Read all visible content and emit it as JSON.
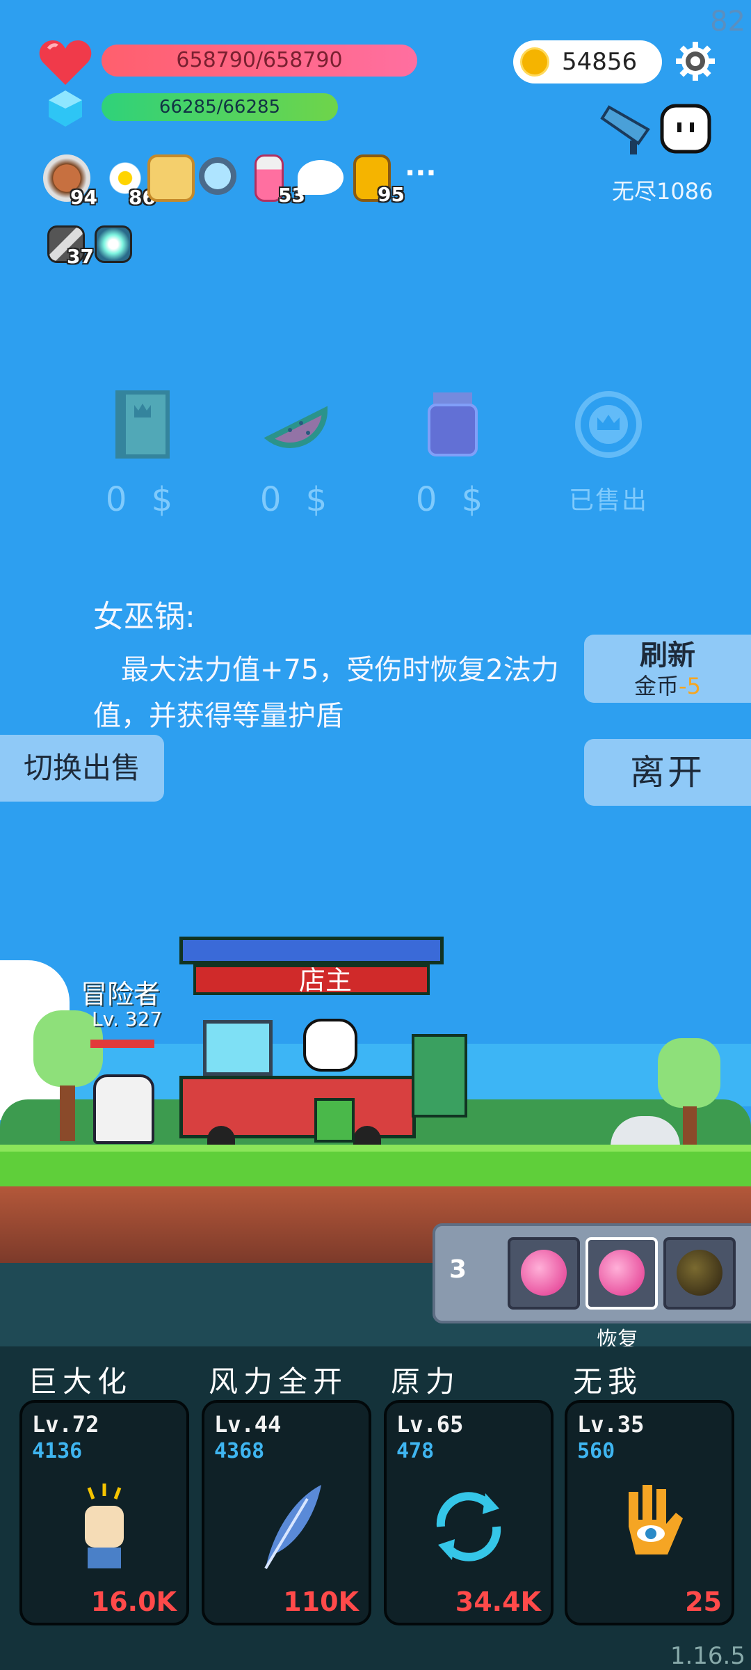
{
  "fps": "82",
  "version": "1.16.5",
  "status": {
    "hp": "658790/658790",
    "mp": "66285/66285",
    "gold": "54856",
    "endless": "无尽1086"
  },
  "buffs": [
    {
      "name": "shield-buff-icon",
      "count": "94"
    },
    {
      "name": "flower-buff-icon",
      "count": "86"
    },
    {
      "name": "scroll-buff-icon",
      "count": ""
    },
    {
      "name": "magnifier-buff-icon",
      "count": ""
    },
    {
      "name": "potion-buff-icon",
      "count": "53"
    },
    {
      "name": "wing-buff-icon",
      "count": ""
    },
    {
      "name": "book-buff-icon",
      "count": "95"
    },
    {
      "name": "sword-buff-icon",
      "count": "37"
    },
    {
      "name": "lightbulb-buff-icon",
      "count": ""
    }
  ],
  "more": "···",
  "shop": {
    "items": [
      {
        "name": "book",
        "price": "0 $"
      },
      {
        "name": "watermelon",
        "price": "0 $"
      },
      {
        "name": "jam-jar",
        "price": "0 $"
      },
      {
        "name": "crown-coin",
        "price": "已售出"
      }
    ],
    "desc_title": "女巫锅:",
    "desc_text": "最大法力值+75，受伤时恢复2法力值，并获得等量护盾",
    "refresh_label": "刷新",
    "refresh_cost_label": "金币",
    "refresh_cost": "-5",
    "leave_label": "离开",
    "switch_label": "切换出售"
  },
  "scene": {
    "adventurer_label": "冒险者",
    "adventurer_level": "Lv. 327",
    "owner_label": "店主"
  },
  "potions": {
    "count": "3",
    "selected_label": "恢复"
  },
  "skills": [
    {
      "title": "巨大化",
      "level": "Lv.72",
      "cost": "4136",
      "price": "16.0K",
      "icon": "fist-icon"
    },
    {
      "title": "风力全开",
      "level": "Lv.44",
      "cost": "4368",
      "price": "110K",
      "icon": "feather-icon"
    },
    {
      "title": "原力",
      "level": "Lv.65",
      "cost": "478",
      "price": "34.4K",
      "icon": "cycle-icon"
    },
    {
      "title": "无我",
      "level": "Lv.35",
      "cost": "560",
      "price": "25",
      "icon": "eye-hand-icon"
    }
  ]
}
